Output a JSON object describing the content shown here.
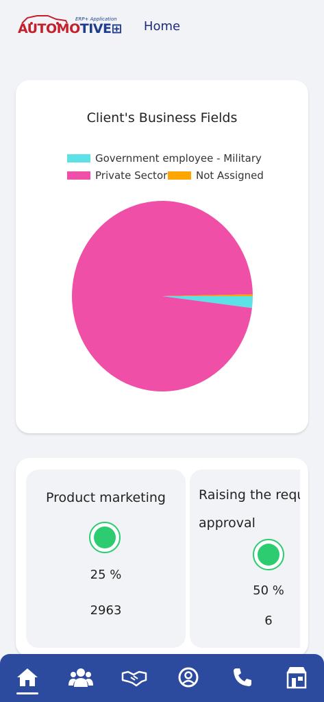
{
  "header": {
    "logo_text_red": "AUTOMO",
    "logo_text_blue": "TIVE",
    "logo_subtitle": "ERP+ Application",
    "page_title": "Home"
  },
  "chart_card": {
    "title": "Client's Business Fields",
    "chart_data": {
      "type": "pie",
      "title": "Client's Business Fields",
      "legend_placement": "top",
      "slices": [
        {
          "name": "Government employee - Military",
          "value": 2.0,
          "color": "#5ce1e6"
        },
        {
          "name": "Private Sector",
          "value": 97.7,
          "color": "#ef4fa6"
        },
        {
          "name": "Not Assigned",
          "value": 0.3,
          "color": "#ffa500"
        }
      ]
    }
  },
  "stats": [
    {
      "label": "Product marketing",
      "percent": "25 %",
      "count": "2963",
      "status_color": "#2ecc71"
    },
    {
      "label_line1": "Raising the reque",
      "label_line2": "approval",
      "percent": "50 %",
      "count": "6",
      "status_color": "#2ecc71"
    }
  ],
  "bottom_nav": [
    {
      "icon": "home-icon",
      "active": true
    },
    {
      "icon": "users-icon",
      "active": false
    },
    {
      "icon": "handshake-icon",
      "active": false
    },
    {
      "icon": "user-circle-icon",
      "active": false
    },
    {
      "icon": "phone-icon",
      "active": false
    },
    {
      "icon": "store-icon",
      "active": false
    }
  ]
}
